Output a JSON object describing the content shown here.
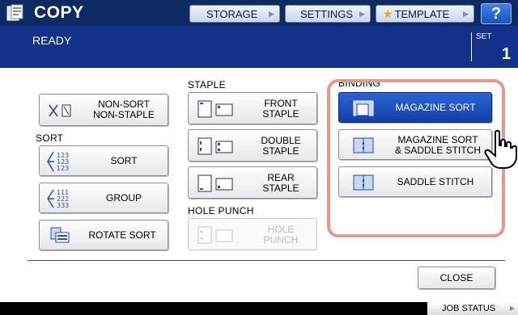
{
  "header": {
    "title": "COPY",
    "storage_label": "STORAGE",
    "settings_label": "SETTINGS",
    "template_label": "TEMPLATE",
    "help_label": "?"
  },
  "status": {
    "text": "READY",
    "set_label": "SET",
    "set_value": "1"
  },
  "finishing": {
    "non_sort_label_1": "NON-SORT",
    "non_sort_label_2": "NON-STAPLE",
    "sort_section": "SORT",
    "sort_label": "SORT",
    "group_label": "GROUP",
    "rotate_sort_label": "ROTATE SORT",
    "staple_section": "STAPLE",
    "front_label_1": "FRONT",
    "front_label_2": "STAPLE",
    "double_label_1": "DOUBLE",
    "double_label_2": "STAPLE",
    "rear_label_1": "REAR",
    "rear_label_2": "STAPLE",
    "hole_punch_section": "HOLE PUNCH",
    "hole_label_1": "HOLE",
    "hole_label_2": "PUNCH",
    "binding_section": "BINDING",
    "magazine_sort_label": "MAGAZINE SORT",
    "mag_saddle_label_1": "MAGAZINE SORT",
    "mag_saddle_label_2": "& SADDLE STITCH",
    "saddle_stitch_label": "SADDLE STITCH"
  },
  "footer": {
    "close_label": "CLOSE",
    "job_status_label": "JOB STATUS"
  },
  "colors": {
    "header_bg": "#0e2a63",
    "status_bg": "#12318a",
    "selected": "#1a4fc0",
    "highlight": "#e39a86"
  }
}
